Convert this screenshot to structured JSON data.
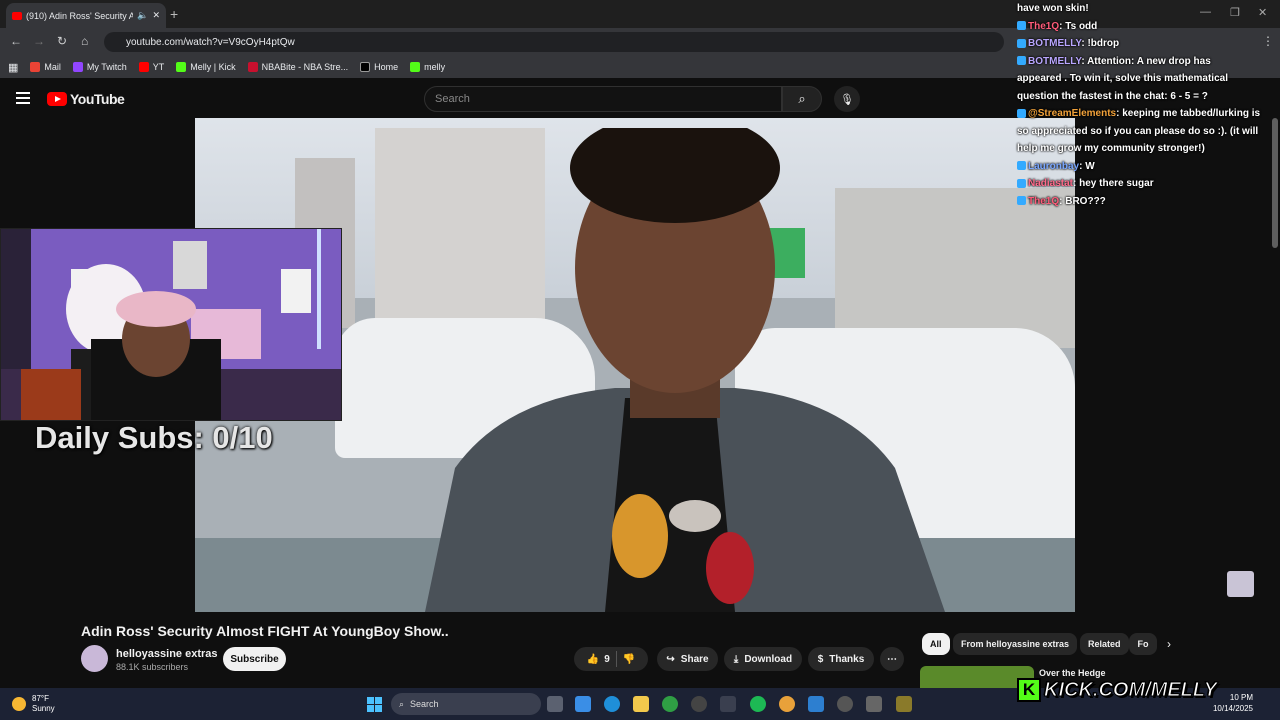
{
  "browser": {
    "tab_title": "(910) Adin Ross' Security Al",
    "url": "youtube.com/watch?v=V9cOyH4ptQw",
    "bookmarks": [
      "Mail",
      "My Twitch",
      "YT",
      "Melly | Kick",
      "NBABite - NBA Stre...",
      "Home",
      "melly"
    ]
  },
  "youtube": {
    "logo_text": "YouTube",
    "search_placeholder": "Search"
  },
  "overlay": {
    "daily_subs": "Daily Subs: 0/10",
    "kick_url": "KICK.COM/MELLY"
  },
  "chat": [
    {
      "user": "",
      "text": "have won skin!"
    },
    {
      "user": "The1Q",
      "text": ": Ts odd",
      "color": "#ff5c7a"
    },
    {
      "user": "BOTMELLY",
      "text": ": !bdrop",
      "color": "#b9a6ff"
    },
    {
      "user": "BOTMELLY",
      "text": ": Attention: A new drop has",
      "color": "#b9a6ff"
    },
    {
      "user": "",
      "text": "appeared . To win it, solve this mathematical"
    },
    {
      "user": "",
      "text": "question the fastest in the chat: 6 - 5 = ?"
    },
    {
      "user": "@StreamElements",
      "text": ": keeping me tabbed/lurking is",
      "color": "#f2a23a"
    },
    {
      "user": "",
      "text": "so appreciated so if you can please do so :). (it will"
    },
    {
      "user": "",
      "text": "help me grow my community stronger!)"
    },
    {
      "user": "Lauronbay",
      "text": ": W",
      "color": "#7aa7ff"
    },
    {
      "user": "Nadiastat",
      "text": ": hey there sugar",
      "color": "#ff6a8a"
    },
    {
      "user": "The1Q",
      "text": ": BRO???",
      "color": "#ff5c7a"
    }
  ],
  "video": {
    "title": "Adin Ross' Security Almost FIGHT At YoungBoy Show..",
    "channel": "helloyassine extras",
    "subscribers": "88.1K subscribers",
    "subscribe_label": "Subscribe",
    "likes": "9",
    "share_label": "Share",
    "download_label": "Download",
    "thanks_label": "Thanks",
    "more_label": "⋯"
  },
  "chips": [
    "All",
    "From helloyassine extras",
    "Related",
    "Fo"
  ],
  "next_video_title": "Over the Hedge",
  "taskbar": {
    "temp": "87°F",
    "condition": "Sunny",
    "search": "Search",
    "time": "10 PM",
    "date": "10/14/2025"
  }
}
